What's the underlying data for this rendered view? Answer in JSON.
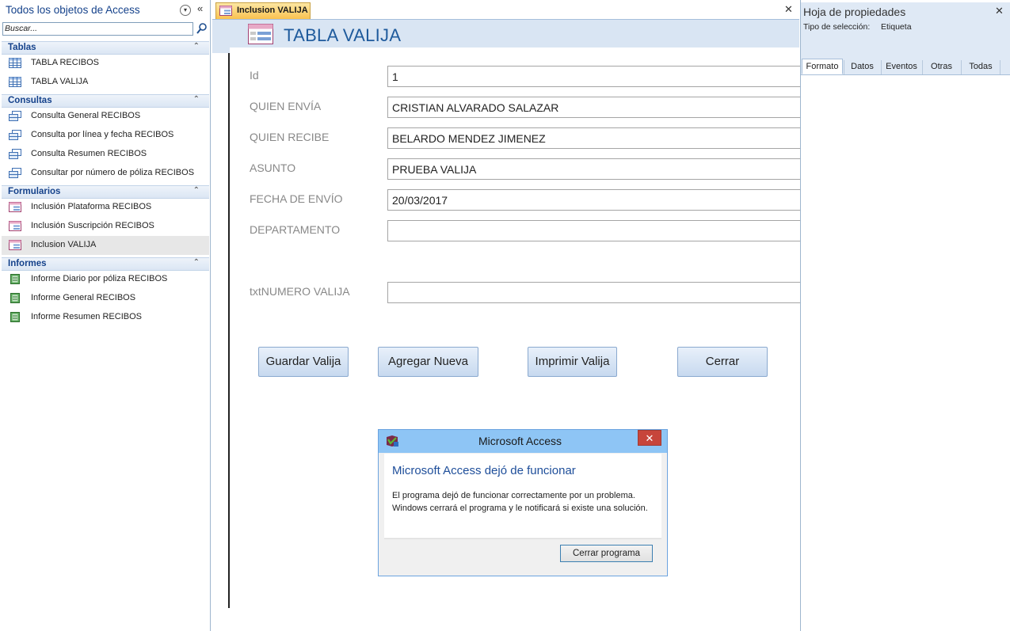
{
  "navigation": {
    "title": "Todos los objetos de Access",
    "search_placeholder": "Buscar...",
    "groups": [
      {
        "label": "Tablas",
        "items": [
          {
            "label": "TABLA RECIBOS",
            "icon": "table-icon"
          },
          {
            "label": "TABLA VALIJA",
            "icon": "table-icon"
          }
        ]
      },
      {
        "label": "Consultas",
        "items": [
          {
            "label": "Consulta General RECIBOS",
            "icon": "query-icon"
          },
          {
            "label": "Consulta por línea y fecha RECIBOS",
            "icon": "query-icon"
          },
          {
            "label": "Consulta Resumen RECIBOS",
            "icon": "query-icon"
          },
          {
            "label": "Consultar por número de póliza RECIBOS",
            "icon": "query-icon"
          }
        ]
      },
      {
        "label": "Formularios",
        "items": [
          {
            "label": "Inclusión Plataforma RECIBOS",
            "icon": "form-icon"
          },
          {
            "label": "Inclusión Suscripción RECIBOS",
            "icon": "form-icon"
          },
          {
            "label": "Inclusion VALIJA",
            "icon": "form-icon",
            "selected": true
          }
        ]
      },
      {
        "label": "Informes",
        "items": [
          {
            "label": "Informe Diario por póliza RECIBOS",
            "icon": "report-icon"
          },
          {
            "label": "Informe General RECIBOS",
            "icon": "report-icon"
          },
          {
            "label": "Informe Resumen RECIBOS",
            "icon": "report-icon"
          }
        ]
      }
    ]
  },
  "document": {
    "tab_label": "Inclusion VALIJA",
    "form_title": "TABLA VALIJA",
    "fields": [
      {
        "label": "Id",
        "value": "1"
      },
      {
        "label": "QUIEN ENVÍA",
        "value": "CRISTIAN ALVARADO SALAZAR"
      },
      {
        "label": "QUIEN RECIBE",
        "value": "BELARDO MENDEZ JIMENEZ"
      },
      {
        "label": "ASUNTO",
        "value": "PRUEBA VALIJA"
      },
      {
        "label": "FECHA DE ENVÍO",
        "value": "20/03/2017"
      },
      {
        "label": "DEPARTAMENTO",
        "value": ""
      },
      {
        "label": "txtNUMERO VALIJA",
        "value": ""
      }
    ],
    "buttons": {
      "save": "Guardar Valija",
      "add": "Agregar Nueva",
      "print": "Imprimir Valija",
      "close": "Cerrar"
    }
  },
  "property_sheet": {
    "title": "Hoja de propiedades",
    "selection_type_label": "Tipo de selección:",
    "selection_type_value": "Etiqueta",
    "tabs": [
      "Formato",
      "Datos",
      "Eventos",
      "Otras",
      "Todas"
    ],
    "active_tab": "Formato"
  },
  "dialog": {
    "title": "Microsoft Access",
    "heading": "Microsoft Access dejó de funcionar",
    "message": "El programa dejó de funcionar correctamente por un problema. Windows cerrará el programa y le notificará si existe una solución.",
    "button": "Cerrar programa"
  },
  "colors": {
    "accent": "#15428b",
    "header_band": "#d9e5f3",
    "active_tab": "#f9c250",
    "dialog_titlebar": "#8ec5f5",
    "dialog_close": "#c7453b"
  }
}
